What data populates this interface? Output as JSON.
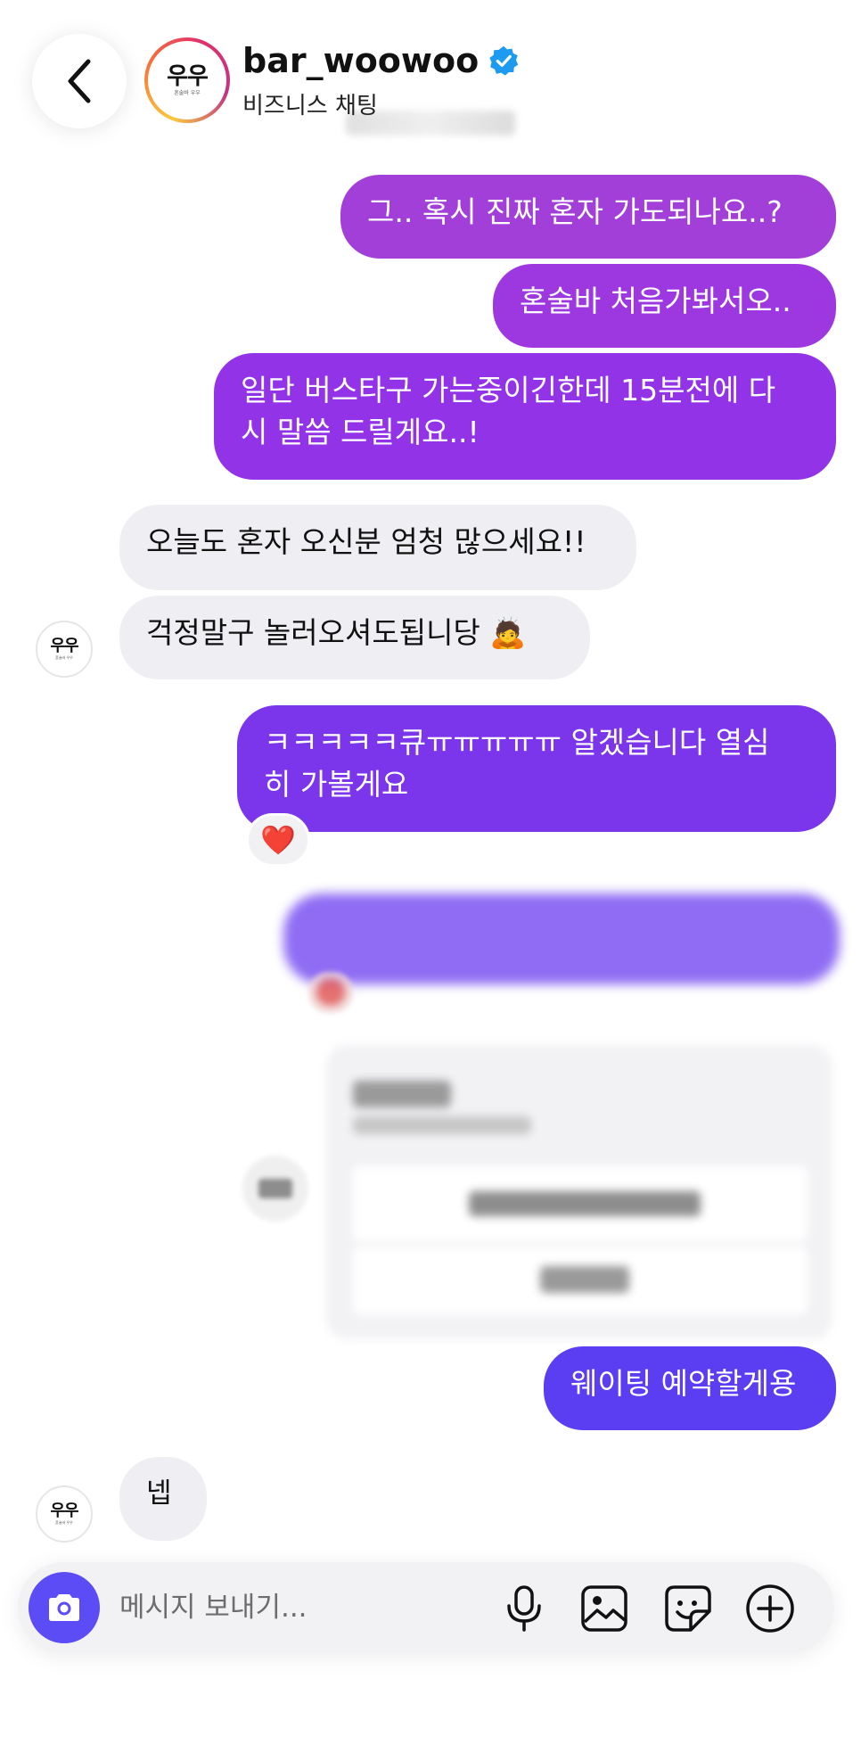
{
  "header": {
    "username": "bar_woowoo",
    "subtitle": "비즈니스 채팅",
    "verified": true,
    "logo_text": "우우",
    "logo_subtext": "혼술바 우우"
  },
  "messages": [
    {
      "side": "out",
      "text": "그.. 혹시 진짜 혼자 가도되나요..?"
    },
    {
      "side": "out",
      "text": "혼술바 처음가봐서오.."
    },
    {
      "side": "out",
      "text": "일단 버스타구 가는중이긴한데 15분전에 다\n시 말씀 드릴게요..!"
    },
    {
      "side": "in",
      "text": "오늘도 혼자 오신분 엄청 많으세요!!"
    },
    {
      "side": "in",
      "text": "걱정말구 놀러오셔도됩니당 🙇"
    },
    {
      "side": "out",
      "text": "ㅋㅋㅋㅋㅋ큐ㅠㅠㅠㅠㅠ 알겠습니다 열심\n히 가볼게요",
      "reaction": "❤️"
    },
    {
      "side": "out",
      "text": "웨이팅 예약할게용"
    },
    {
      "side": "in",
      "text": "넵"
    }
  ],
  "composer": {
    "placeholder": "메시지 보내기..."
  },
  "colors": {
    "accent": "#5b4cf6",
    "bubble_out_top": "#a23fd8",
    "bubble_out_bottom": "#5b3df2",
    "bubble_in": "#efeff3"
  },
  "icons": [
    "back-icon",
    "verified-icon",
    "camera-icon",
    "microphone-icon",
    "gallery-icon",
    "sticker-icon",
    "plus-icon"
  ]
}
